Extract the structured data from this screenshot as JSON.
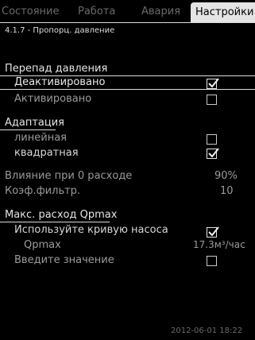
{
  "tabs": [
    "Состояние",
    "Работа",
    "Авария",
    "Настройки"
  ],
  "breadcrumb": "4.1.7 - Пропорц. давление",
  "sections": {
    "diff": {
      "title": "Перепад давления",
      "opt1": "Деактивировано",
      "opt2": "Активировано"
    },
    "adapt": {
      "title": "Адаптация",
      "opt1": "линейная",
      "opt2": "квадратная"
    },
    "params": {
      "influence_label": "Влияние при 0 расходе",
      "influence_value": "90%",
      "filter_label": "Коэф.фильтр.",
      "filter_value": "10"
    },
    "qmax": {
      "title": "Макс. расход Qpmax",
      "use_curve": "Используйте кривую насоса",
      "qpmax_label": "Qpmax",
      "qpmax_value": "17.3м³/час",
      "enter_value": "Введите значение"
    }
  },
  "footer_timestamp": "2012-06-01 18:22",
  "checkboxes": {
    "diff_deactivated": true,
    "diff_activated": false,
    "adapt_linear": false,
    "adapt_quadratic": true,
    "use_curve": true,
    "enter_value": false
  }
}
